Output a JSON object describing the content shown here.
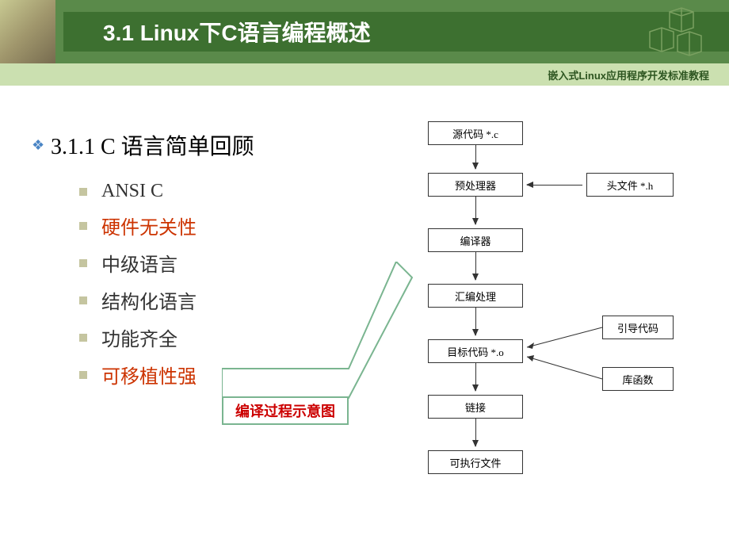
{
  "header": {
    "title": "3.1 Linux下C语言编程概述",
    "subtitle": "嵌入式Linux应用程序开发标准教程"
  },
  "section": {
    "title": "3.1.1 C 语言简单回顾",
    "bullets": [
      {
        "text": "ANSI C",
        "red": false
      },
      {
        "text": "硬件无关性",
        "red": true
      },
      {
        "text": "中级语言",
        "red": false
      },
      {
        "text": "结构化语言",
        "red": false
      },
      {
        "text": "功能齐全",
        "red": false
      },
      {
        "text": "可移植性强",
        "red": true
      }
    ]
  },
  "callout": {
    "label": "编译过程示意图"
  },
  "flowchart": {
    "source": "源代码 *.c",
    "preprocess": "预处理器",
    "header_file": "头文件 *.h",
    "compiler": "编译器",
    "assembler": "汇编处理",
    "object": "目标代码 *.o",
    "boot_code": "引导代码",
    "lib_func": "库函数",
    "linker": "链接",
    "executable": "可执行文件"
  }
}
